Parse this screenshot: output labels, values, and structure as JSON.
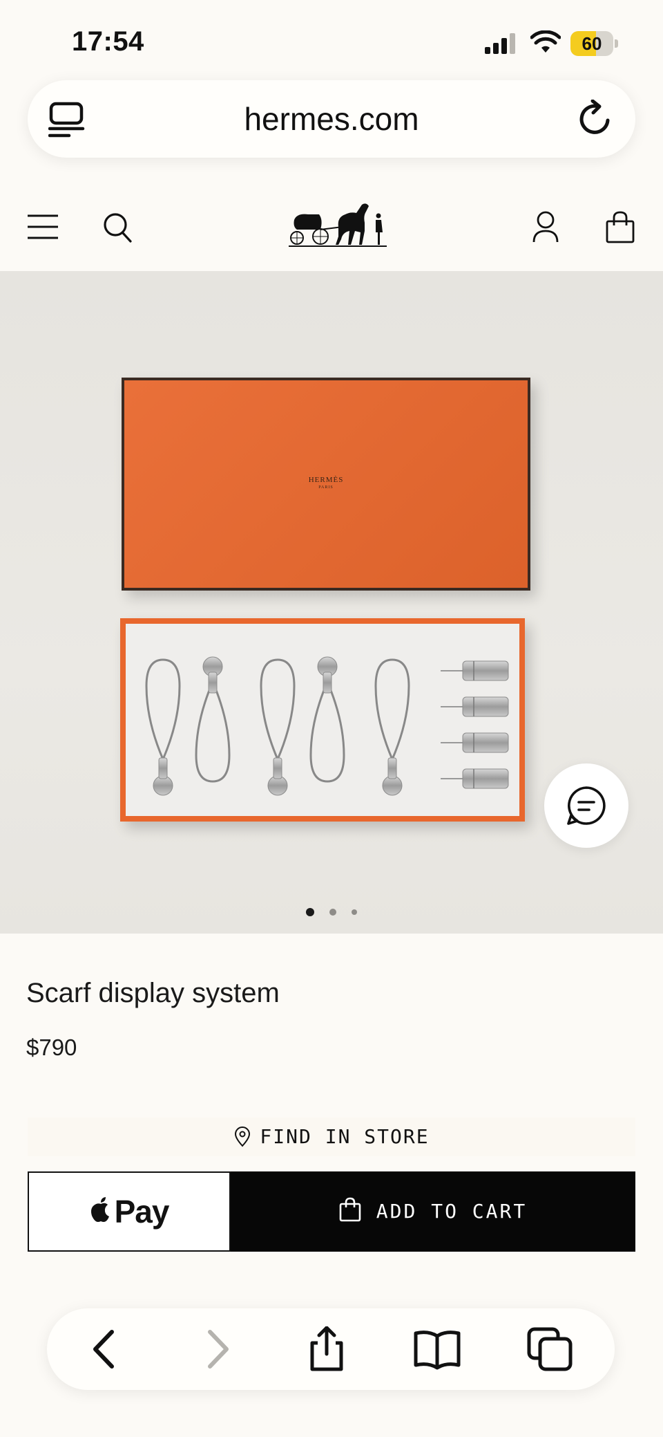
{
  "status_bar": {
    "time": "17:54",
    "battery": "60",
    "battery_level": 0.6
  },
  "browser": {
    "url": "hermes.com"
  },
  "site_header": {
    "logo_alt": "Hermès carriage logo"
  },
  "product": {
    "image_dots_total": 3,
    "image_dots_active": 1,
    "box_brand": "HERMÈS",
    "box_brand_sub": "PARIS",
    "name": "Scarf display system",
    "price": "$790"
  },
  "actions": {
    "find_in_store": "FIND IN STORE",
    "apple_pay": "Pay",
    "add_to_cart": "ADD TO CART"
  },
  "icons": {
    "menu": "hamburger-menu-icon",
    "search": "search-icon",
    "account": "account-icon",
    "bag": "shopping-bag-icon",
    "chat": "chat-icon"
  },
  "colors": {
    "accent_orange": "#e8672d",
    "button_black": "#070707",
    "page_bg": "#fcfaf6"
  }
}
